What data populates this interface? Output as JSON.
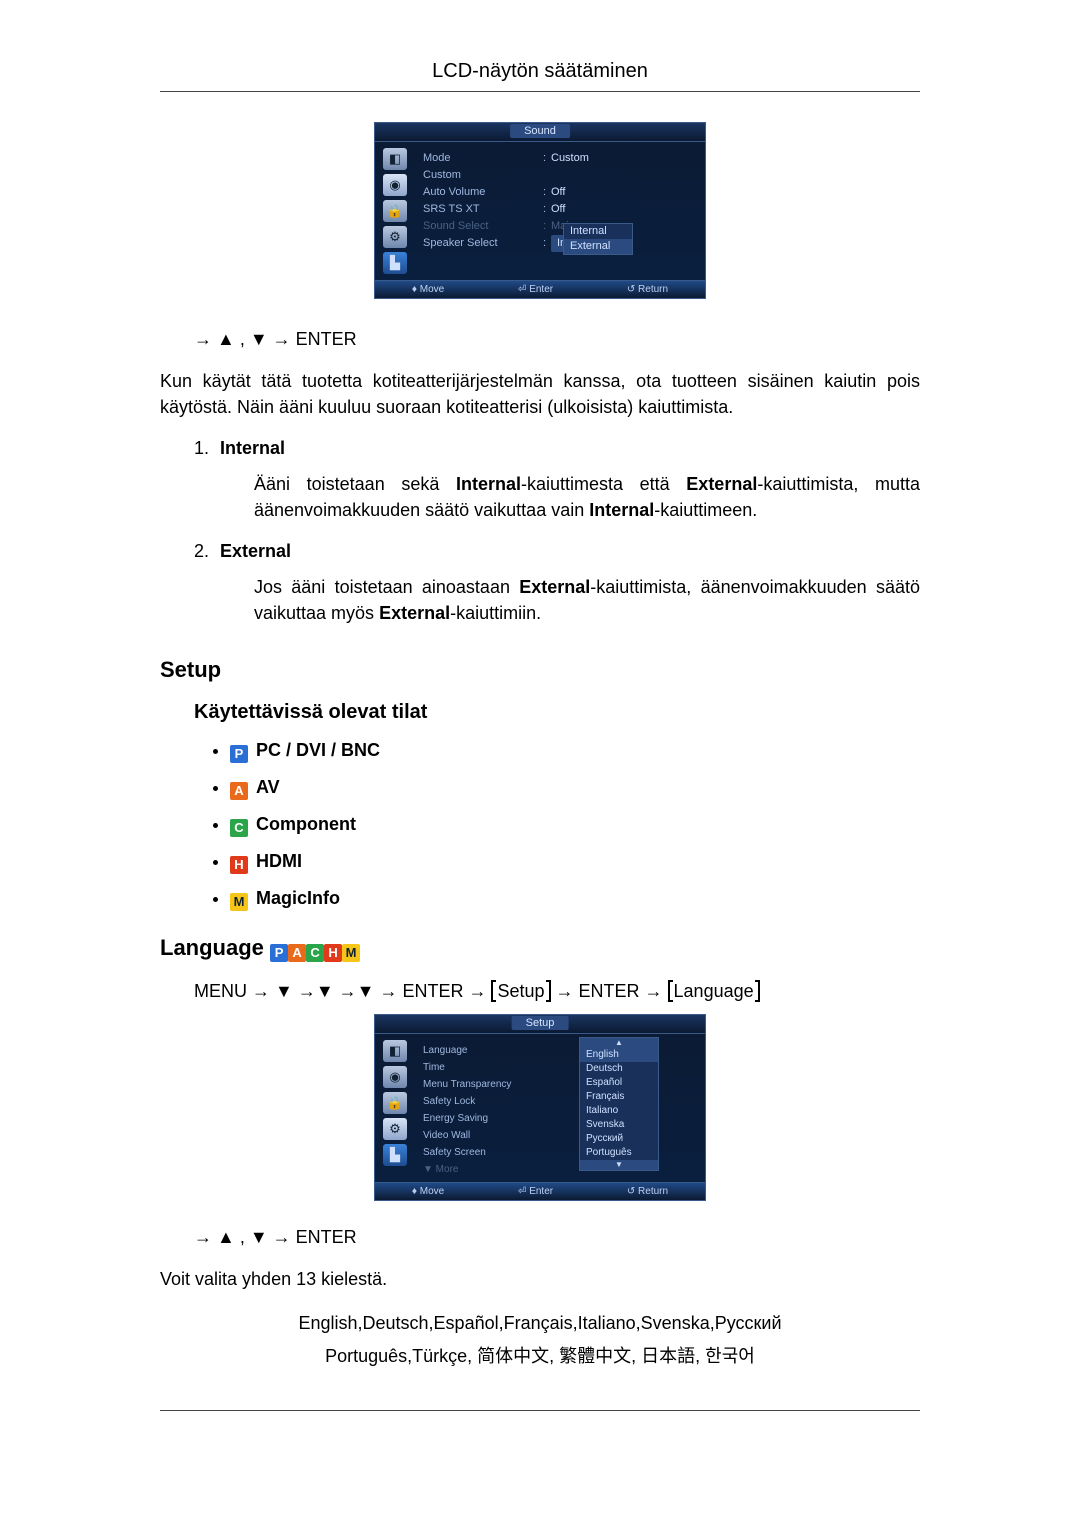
{
  "header": {
    "title": "LCD-näytön säätäminen"
  },
  "osd1": {
    "title": "Sound",
    "rows": [
      {
        "label": "Mode",
        "value": "Custom",
        "colon": ":"
      },
      {
        "label": "Custom",
        "value": "",
        "colon": ""
      },
      {
        "label": "Auto Volume",
        "value": "Off",
        "colon": ":"
      },
      {
        "label": "SRS TS XT",
        "value": "Off",
        "colon": ":"
      },
      {
        "label": "Sound Select",
        "value": "Main",
        "colon": ":",
        "dim": true
      },
      {
        "label": "Speaker Select",
        "value": "Internal",
        "colon": ":",
        "sel": true
      }
    ],
    "drop": {
      "options": [
        "Internal",
        "External"
      ],
      "highlight": 1
    },
    "footer": {
      "move": "♦ Move",
      "enter": "⏎ Enter",
      "ret": "↺ Return"
    }
  },
  "nav1": "→ ▲ , ▼ → ENTER",
  "para1_a": "Kun käytät tätä tuotetta kotiteatterijärjestelmän kanssa, ota tuotteen sisäinen kaiutin pois käytöstä. Näin ääni kuuluu suoraan kotiteatterisi (ulkoisista) kaiuttimista.",
  "list": {
    "items": [
      {
        "num": "1.",
        "label": "Internal",
        "text_a": "Ääni toistetaan sekä ",
        "text_b": "Internal",
        "text_c": "-kaiuttimesta että ",
        "text_d": "External",
        "text_e": "-kaiuttimista, mutta äänenvoimakkuuden säätö vaikuttaa vain ",
        "text_f": "Internal",
        "text_g": "-kaiuttimeen."
      },
      {
        "num": "2.",
        "label": "External",
        "text_a": "Jos ääni toistetaan ainoastaan ",
        "text_b": "External",
        "text_c": "-kaiuttimista, äänenvoimakkuuden säätö vaikuttaa myös ",
        "text_d": "External",
        "text_e": "-kaiuttimiin."
      }
    ]
  },
  "setup": {
    "heading": "Setup",
    "sub": "Käytettävissä olevat tilat",
    "modes": [
      {
        "badge": "P",
        "cls": "bP",
        "label": "PC / DVI / BNC"
      },
      {
        "badge": "A",
        "cls": "bA",
        "label": "AV"
      },
      {
        "badge": "C",
        "cls": "bC",
        "label": "Component"
      },
      {
        "badge": "H",
        "cls": "bH",
        "label": "HDMI"
      },
      {
        "badge": "M",
        "cls": "bM",
        "label": "MagicInfo"
      }
    ]
  },
  "langsec": {
    "heading": "Language",
    "navline": {
      "a": "MENU → ▼ →▼ →▼ → ENTER → ",
      "b": "Setup",
      "c": " → ENTER → ",
      "d": "Language"
    }
  },
  "osd2": {
    "title": "Setup",
    "rows": [
      {
        "label": "Language",
        "value": "English",
        "sel": true
      },
      {
        "label": "Time",
        "value": ""
      },
      {
        "label": "Menu Transparency",
        "value": ""
      },
      {
        "label": "Safety Lock",
        "value": ""
      },
      {
        "label": "Energy Saving",
        "value": ""
      },
      {
        "label": "Video Wall",
        "value": ""
      },
      {
        "label": "Safety Screen",
        "value": ""
      }
    ],
    "more": "▼ More",
    "drop": {
      "options": [
        "English",
        "Deutsch",
        "Español",
        "Français",
        "Italiano",
        "Svenska",
        "Русский",
        "Português"
      ],
      "highlight": 0
    },
    "footer": {
      "move": "♦ Move",
      "enter": "⏎ Enter",
      "ret": "↺ Return"
    }
  },
  "nav2": "→ ▲ , ▼ → ENTER",
  "para2": "Voit valita yhden 13 kielestä.",
  "languages": {
    "line1": "English,Deutsch,Español,Français,Italiano,Svenska,Русский",
    "line2": "Português,Türkçe, 简体中文,  繁體中文, 日本語, 한국어"
  }
}
